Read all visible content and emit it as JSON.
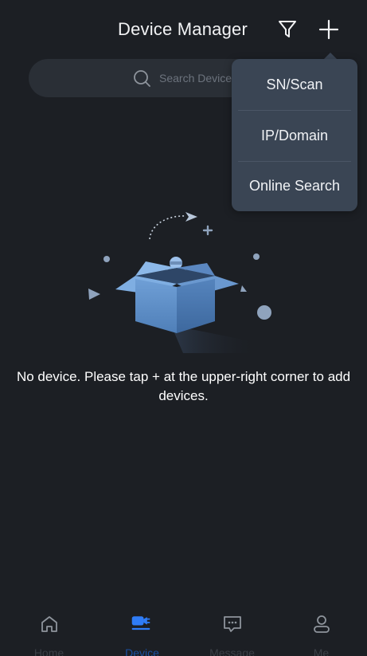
{
  "header": {
    "title": "Device Manager",
    "filter_icon": "filter-icon",
    "add_icon": "plus-icon"
  },
  "search": {
    "placeholder": "Search Device",
    "icon": "search-icon"
  },
  "add_menu": {
    "items": [
      {
        "label": "SN/Scan"
      },
      {
        "label": "IP/Domain"
      },
      {
        "label": "Online Search"
      }
    ]
  },
  "empty_state": {
    "illustration": "empty-box-illustration",
    "message": "No device. Please tap + at the upper-right corner to add devices."
  },
  "tabbar": {
    "items": [
      {
        "label": "Home",
        "icon": "home-icon",
        "active": false
      },
      {
        "label": "Device",
        "icon": "device-camera-icon",
        "active": true
      },
      {
        "label": "Message",
        "icon": "message-icon",
        "active": false
      },
      {
        "label": "Me",
        "icon": "person-icon",
        "active": false
      }
    ]
  },
  "colors": {
    "background": "#1c1f24",
    "search_bg": "#2a2f36",
    "menu_bg": "#3a4554",
    "accent": "#2f7cf6",
    "icon_inactive": "#8e949c"
  }
}
